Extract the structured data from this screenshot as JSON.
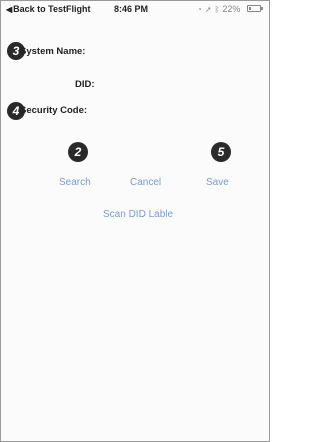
{
  "status_bar": {
    "back_text": "Back to TestFlight",
    "time": "8:46 PM",
    "battery": "22%",
    "battery_level": 0.22
  },
  "form": {
    "system_name_label": "System Name:",
    "did_label": "DID:",
    "security_code_label": "Security Code:",
    "system_name_value": "",
    "did_value": "",
    "security_code_value": ""
  },
  "annotations": {
    "n3": "3",
    "n4": "4",
    "n2": "2",
    "n5": "5"
  },
  "actions": {
    "search": "Search",
    "cancel": "Cancel",
    "save": "Save",
    "scan": "Scan DID Lable"
  },
  "colors": {
    "link": "#7a9cc8",
    "badge": "#2a2a2a"
  }
}
